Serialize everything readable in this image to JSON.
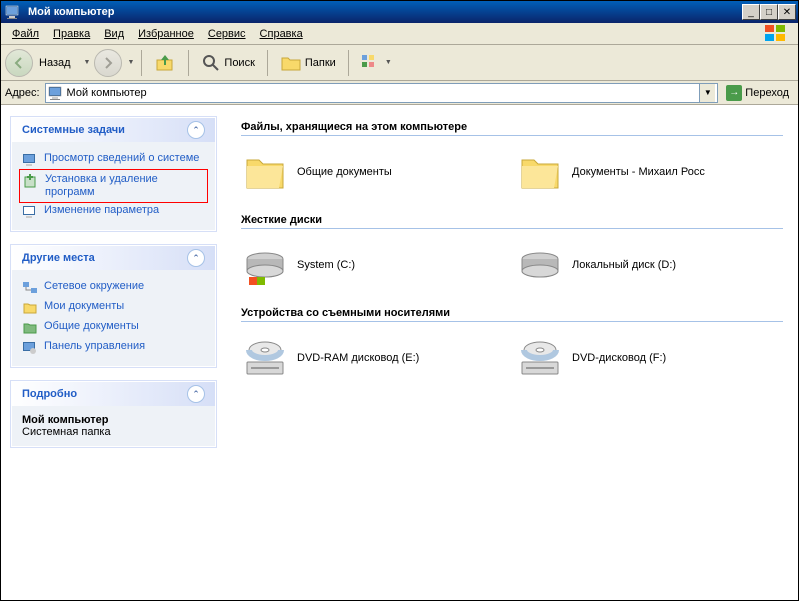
{
  "title": "Мой компьютер",
  "menu": [
    "Файл",
    "Правка",
    "Вид",
    "Избранное",
    "Сервис",
    "Справка"
  ],
  "toolbar": {
    "back": "Назад",
    "search": "Поиск",
    "folders": "Папки"
  },
  "address": {
    "label": "Адрес:",
    "value": "Мой компьютер",
    "go": "Переход"
  },
  "panels": {
    "system": {
      "title": "Системные задачи",
      "items": [
        "Просмотр сведений о системе",
        "Установка и удаление программ",
        "Изменение параметра"
      ]
    },
    "places": {
      "title": "Другие места",
      "items": [
        "Сетевое окружение",
        "Мои документы",
        "Общие документы",
        "Панель управления"
      ]
    },
    "details": {
      "title": "Подробно",
      "name": "Мой компьютер",
      "type": "Системная папка"
    }
  },
  "sections": {
    "files": {
      "title": "Файлы, хранящиеся на этом компьютере",
      "items": [
        "Общие документы",
        "Документы - Михаил Росс"
      ]
    },
    "disks": {
      "title": "Жесткие диски",
      "items": [
        "System (C:)",
        "Локальный диск (D:)"
      ]
    },
    "removable": {
      "title": "Устройства со съемными носителями",
      "items": [
        "DVD-RAM дисковод (E:)",
        "DVD-дисковод (F:)"
      ]
    }
  }
}
